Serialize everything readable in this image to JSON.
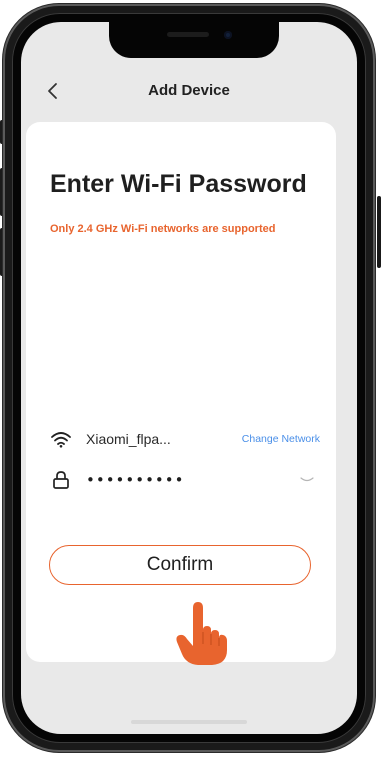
{
  "header": {
    "title": "Add Device"
  },
  "icons": {
    "back": "chevron-left-icon",
    "wifi": "wifi-icon",
    "lock": "lock-icon",
    "eye": "eye-closed-icon",
    "hand": "pointing-hand-icon"
  },
  "main": {
    "heading": "Enter Wi-Fi Password",
    "warning": "Only 2.4 GHz Wi-Fi networks are supported",
    "network": {
      "ssid": "Xiaomi_flpa...",
      "change_label": "Change Network"
    },
    "password": {
      "value": "••••••••••"
    },
    "confirm_label": "Confirm"
  },
  "colors": {
    "accent": "#e8642e",
    "link": "#4a8fe8",
    "screen_bg": "#e9e9e9",
    "card_bg": "#ffffff"
  }
}
